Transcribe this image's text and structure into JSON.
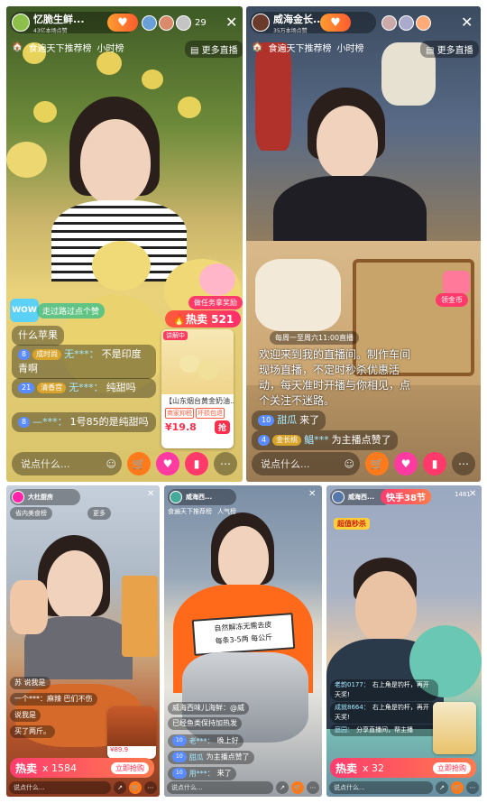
{
  "panels": [
    {
      "host": "忆脆生鲜...",
      "sub": "43亿本场点赞",
      "viewers": "29",
      "rank1": "食遍天下推荐榜",
      "rank2": "小时榜",
      "more": "更多直播",
      "follow_icon": "plus-heart",
      "task": "做任务拿奖励",
      "wow_hint": "走过路过点个赞",
      "comments": [
        {
          "level": "",
          "tag": "",
          "user": "",
          "text": "什么苹果"
        },
        {
          "level": "8",
          "tag": "成时尚",
          "user": "无***：",
          "text": "不是印度青啊"
        },
        {
          "level": "21",
          "tag": "清香宫",
          "user": "无***：",
          "text": "纯甜吗"
        },
        {
          "level": "8",
          "tag": "",
          "user": "—***：",
          "text": "1号85的是纯甜吗"
        }
      ],
      "hot_label": "热卖",
      "hot_count": "521",
      "card": {
        "badge": "讲解中",
        "title": "【山东烟台黄金奶油...",
        "tag1": "商家抑税",
        "tag2": "坏损包退",
        "price": "¥19.8",
        "grab": "抢"
      },
      "input": "说点什么..."
    },
    {
      "host": "威海金长...",
      "sub": "35万本场点赞",
      "rank1": "食遍天下推荐榜",
      "rank2": "小时榜",
      "more": "更多直播",
      "side_tag": "领金币",
      "notice_pin": "每周一至周六11:00直播",
      "overlay": "欢迎来到我的直播间。制作车间现场直播，不定时秒杀优惠活动，每天准时开播与你相见，点个关注不迷路。",
      "comments": [
        {
          "level": "10",
          "tag": "",
          "user": "甜瓜",
          "text": "来了"
        },
        {
          "level": "4",
          "tag": "金长桃",
          "user": "鲳***",
          "text": "为主播点赞了"
        }
      ],
      "input": "说点什么..."
    },
    {
      "host": "大杜厨房",
      "rank": "省内美食榜",
      "more": "更多",
      "comments": [
        {
          "user": "苏",
          "text": "说我是"
        },
        {
          "user": "",
          "text": "一个***：麻辣 巴们不伤"
        },
        {
          "user": "",
          "text": "说我是"
        },
        {
          "user": "",
          "text": "买了两斤。"
        }
      ],
      "hot_label": "热卖",
      "hot_count": "1584",
      "buy": "立即抢购",
      "card_price": "¥89.9",
      "input": "说点什么..."
    },
    {
      "host": "威海西... ",
      "rank1": "食遍天下推荐榜",
      "rank2": "人气榜",
      "sign": "自然解冻无需去皮",
      "sign2": "每条3-5两 每公斤",
      "comments": [
        {
          "user": "",
          "text": "威海西味儿海鲜：@威"
        },
        {
          "user": "",
          "text": "已经鱼类保持加热发"
        },
        {
          "level": "10",
          "user": "老***：",
          "text": "晚上好"
        },
        {
          "level": "10",
          "user": "甜瓜",
          "text": "为主播点赞了"
        },
        {
          "level": "10",
          "user": "用***：",
          "text": "来了"
        }
      ],
      "input": "说点什么..."
    },
    {
      "host": "威海西...",
      "count": "1481",
      "banner": "快手38节",
      "banner_sub": "超值秒杀",
      "comments": [
        {
          "user": "老韵0177：",
          "text": "右上角是钓杆，再开天奖!"
        },
        {
          "user": "成就8664：",
          "text": "右上角是钓杆，再开天奖!"
        },
        {
          "user": "庭园：",
          "text": "分享直播间，帮主播"
        }
      ],
      "hot_label": "热卖",
      "hot_count": "32",
      "buy": "立即抢购",
      "input": "说点什么..."
    }
  ]
}
